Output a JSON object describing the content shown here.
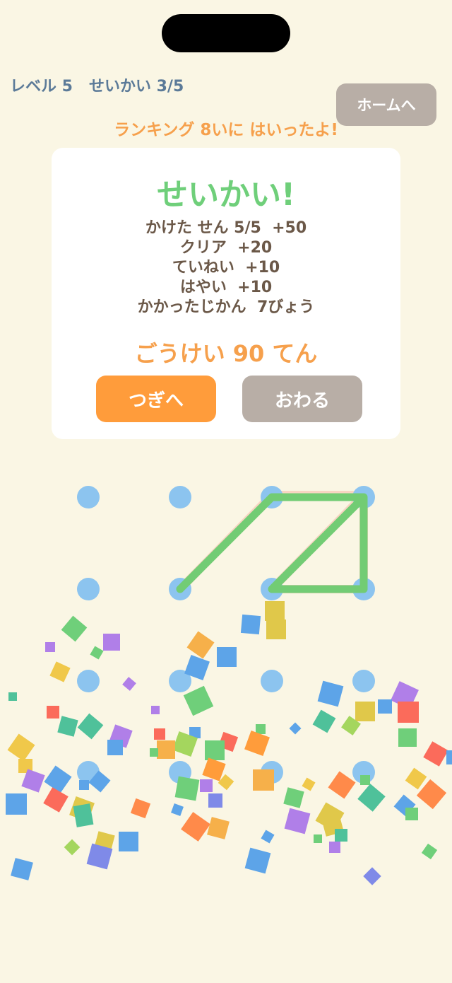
{
  "header": {
    "level_status": "レベル 5   せいかい 3/5",
    "home_button": "ホームへ",
    "ranking_message": "ランキング 8いに はいったよ!"
  },
  "result_card": {
    "title": "せいかい!",
    "breakdown": [
      "かけた せん 5/5  +50",
      "クリア  +20",
      "ていねい  +10",
      "はやい  +10",
      "かかったじかん  7びょう"
    ],
    "total": "ごうけい 90 てん",
    "next_button": "つぎへ",
    "end_button": "おわる"
  },
  "colors": {
    "background": "#faf6e4",
    "dot": "#8cc4ef",
    "line": "#72cc74",
    "accent_orange": "#ff9c3b",
    "success_green": "#6fcf7a",
    "neutral_button": "#b8aea6"
  }
}
